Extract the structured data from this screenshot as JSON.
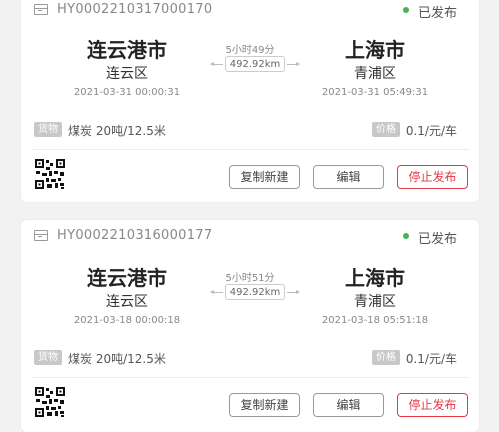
{
  "orders": [
    {
      "order_no": "HY0002210317000170",
      "status": "已发布",
      "from": {
        "city": "连云港市",
        "district": "连云区",
        "time": "2021-03-31 00:00:31"
      },
      "to": {
        "city": "上海市",
        "district": "青浦区",
        "time": "2021-03-31 05:49:31"
      },
      "duration": "5小时49分",
      "distance": "492.92km",
      "cargo_tag": "货物",
      "cargo": "煤炭 20吨/12.5米",
      "price_tag": "价格",
      "price": "0.1/元/车",
      "buttons": {
        "copy": "复制新建",
        "edit": "编辑",
        "stop": "停止发布"
      }
    },
    {
      "order_no": "HY0002210316000177",
      "status": "已发布",
      "from": {
        "city": "连云港市",
        "district": "连云区",
        "time": "2021-03-18 00:00:18"
      },
      "to": {
        "city": "上海市",
        "district": "青浦区",
        "time": "2021-03-18 05:51:18"
      },
      "duration": "5小时51分",
      "distance": "492.92km",
      "cargo_tag": "货物",
      "cargo": "煤炭 20吨/12.5米",
      "price_tag": "价格",
      "price": "0.1/元/车",
      "buttons": {
        "copy": "复制新建",
        "edit": "编辑",
        "stop": "停止发布"
      }
    }
  ],
  "colors": {
    "status_dot": "#4caf50",
    "stop_button": "#e63946",
    "tag_bg": "#c8c8c8"
  },
  "icons": {
    "header": "document-icon",
    "footer": "qr-code-icon"
  }
}
